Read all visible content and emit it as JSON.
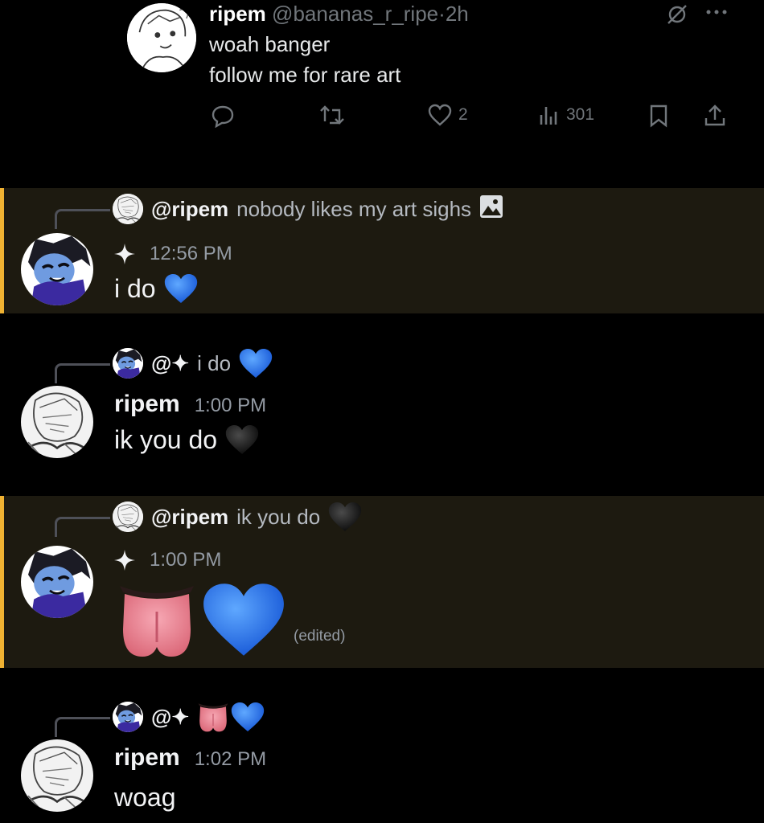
{
  "tweet": {
    "name": "ripem",
    "handle": "@bananas_r_ripe",
    "separator": "·",
    "time": "2h",
    "lines": [
      "woah banger",
      "follow me for rare art"
    ],
    "likes": "2",
    "views": "301",
    "icons": [
      "no-bell-icon",
      "more-icon",
      "reply-icon",
      "retweet-icon",
      "heart-icon",
      "views-icon",
      "bookmark-icon",
      "share-icon"
    ]
  },
  "messages": [
    {
      "reply_author": "@ripem",
      "reply_text": "nobody likes my art sighs",
      "reply_icon": "image-icon",
      "author_icon": "sparkle-icon",
      "time": "12:56 PM",
      "content": "i do",
      "emoji": [
        "blue-heart"
      ]
    },
    {
      "reply_author": "@✦",
      "reply_text": "i do",
      "reply_emoji": [
        "blue-heart"
      ],
      "author": "ripem",
      "time": "1:00 PM",
      "content": "ik you do",
      "emoji": [
        "black-heart"
      ]
    },
    {
      "reply_author": "@ripem",
      "reply_text": "ik you do",
      "reply_emoji": [
        "black-heart"
      ],
      "author_icon": "sparkle-icon",
      "time": "1:00 PM",
      "emoji": [
        "tongue",
        "blue-heart"
      ],
      "edited": "(edited)"
    },
    {
      "reply_author": "@✦",
      "reply_emoji": [
        "tongue",
        "blue-heart"
      ],
      "author": "ripem",
      "time": "1:02 PM",
      "content": "woag"
    }
  ],
  "colors": {
    "highlight_bg": "#1d1a10",
    "highlight_border": "#f0b232",
    "blue_heart": "#2b7bf0",
    "black_heart": "#1e1e1e",
    "muted": "#949ba4"
  }
}
